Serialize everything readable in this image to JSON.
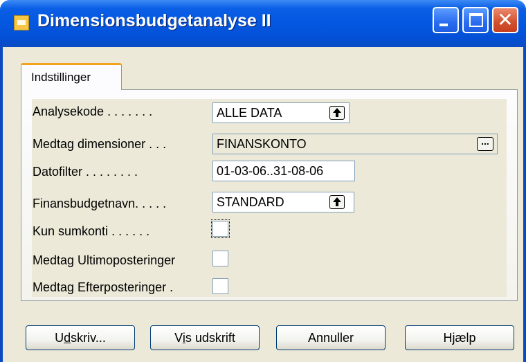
{
  "window": {
    "title": "Dimensionsbudgetanalyse II",
    "minimize_label": "",
    "maximize_label": "",
    "close_label": "✕"
  },
  "tabs": [
    {
      "label": "Indstillinger",
      "active": true
    }
  ],
  "fields": {
    "analysekode": {
      "label": "Analysekode",
      "dots": " . . . . . . .",
      "value": "ALLE DATA"
    },
    "medtag_dimensioner": {
      "label": "Medtag dimensioner",
      "dots": " . . .",
      "value": "FINANSKONTO",
      "button": "..."
    },
    "datofilter": {
      "label": "Datofilter",
      "dots": " . . . . . . . .",
      "value": "01-03-06..31-08-06"
    },
    "finansbudgetnavn": {
      "label": "Finansbudgetnavn.",
      "dots": " . . . .",
      "value": "STANDARD"
    },
    "kun_sumkonti": {
      "label": "Kun sumkonti",
      "dots": " . . . . . .",
      "checked": false
    },
    "medtag_ultimo": {
      "label": "Medtag Ultimoposteringer",
      "dots": "",
      "checked": false
    },
    "medtag_efter": {
      "label": "Medtag Efterposteringer",
      "dots": " .",
      "checked": false
    }
  },
  "buttons": {
    "print": {
      "pre": "U",
      "mnemonic": "d",
      "post": "skriv..."
    },
    "preview": {
      "pre": "V",
      "mnemonic": "i",
      "post": "s udskrift"
    },
    "cancel": {
      "label": "Annuller"
    },
    "help": {
      "label": "Hjælp"
    }
  },
  "colors": {
    "titlebar": "#0457e0",
    "tab_accent": "#f2a31e",
    "client_bg": "#ece9d8",
    "close_button": "#d2502d"
  }
}
